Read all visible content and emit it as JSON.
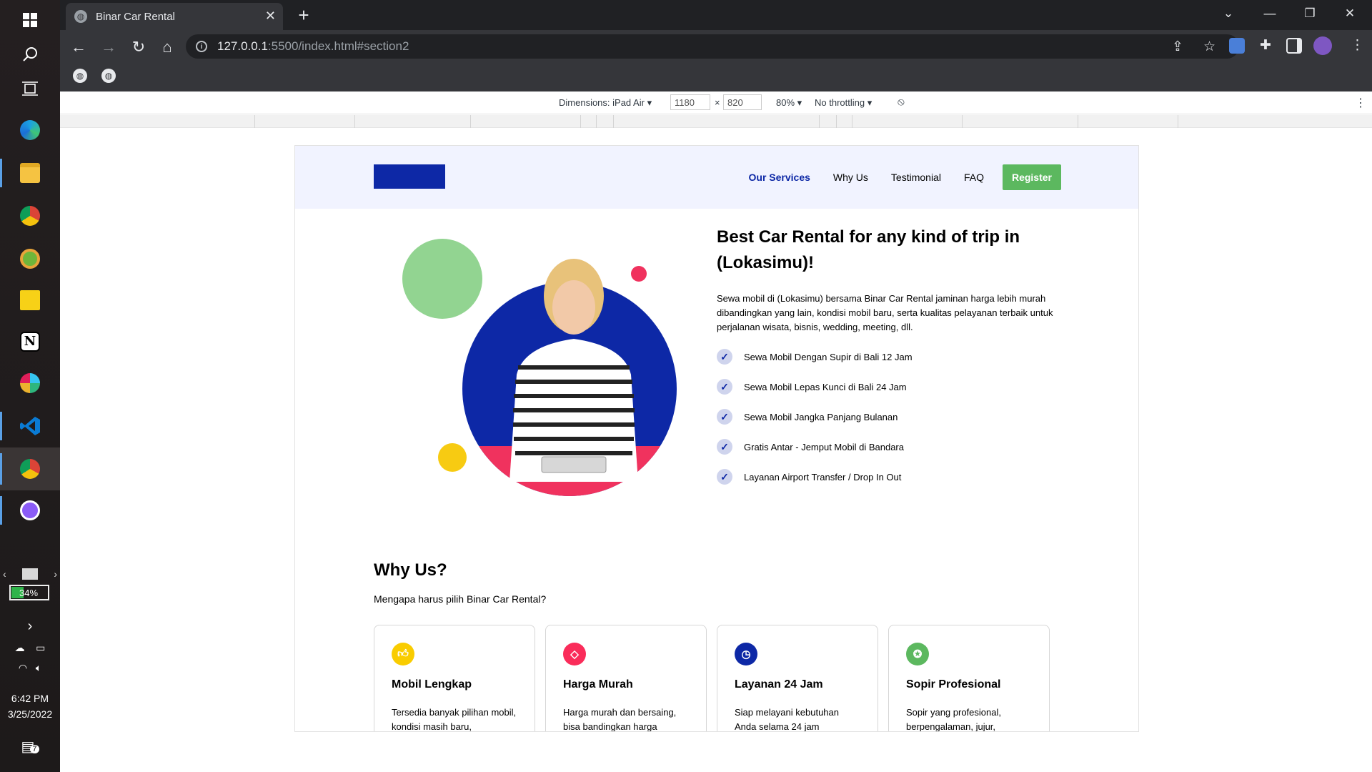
{
  "taskbar": {
    "apps": [
      {
        "icon": "windows-start-icon",
        "color": "#ffffff"
      },
      {
        "icon": "search-icon",
        "color": "#ffffff"
      },
      {
        "icon": "task-view-icon",
        "color": "#ffffff"
      },
      {
        "icon": "edge-icon",
        "color": "#1ba1e2"
      },
      {
        "icon": "file-explorer-icon",
        "color": "#f5c342"
      },
      {
        "icon": "chrome-icon",
        "color": "#db4437"
      },
      {
        "icon": "chameleon-app-icon",
        "color": "#e8a43a"
      },
      {
        "icon": "sticky-notes-icon",
        "color": "#f7d117"
      },
      {
        "icon": "notion-icon",
        "color": "#ffffff"
      },
      {
        "icon": "slack-icon",
        "color": "#e01e5a"
      },
      {
        "icon": "vscode-icon",
        "color": "#0a7bd4"
      },
      {
        "icon": "chrome-active-icon",
        "color": "#db4437"
      },
      {
        "icon": "github-desktop-icon",
        "color": "#8b5cf6"
      }
    ],
    "battery": "34%",
    "time": "6:42 PM",
    "date": "3/25/2022",
    "notification_count": "7"
  },
  "browser": {
    "tab_title": "Binar Car Rental",
    "url_host": "127.0.0.1",
    "url_path": ":5500/index.html#section2"
  },
  "devtools": {
    "dimensions_label": "Dimensions: iPad Air",
    "width": "1180",
    "height": "820",
    "times": "×",
    "zoom": "80%",
    "throttling": "No throttling"
  },
  "site": {
    "nav": {
      "items": [
        "Our Services",
        "Why Us",
        "Testimonial",
        "FAQ"
      ],
      "register": "Register"
    },
    "hero": {
      "title": "Best Car Rental for any kind of trip in (Lokasimu)!",
      "description": "Sewa mobil di (Lokasimu) bersama Binar Car Rental jaminan harga lebih murah dibandingkan yang lain, kondisi mobil baru, serta kualitas pelayanan terbaik untuk perjalanan wisata, bisnis, wedding, meeting, dll.",
      "features": [
        "Sewa Mobil Dengan Supir di Bali 12 Jam",
        "Sewa Mobil Lepas Kunci di Bali 24 Jam",
        "Sewa Mobil Jangka Panjang Bulanan",
        "Gratis Antar - Jemput Mobil di Bandara",
        "Layanan Airport Transfer / Drop In Out"
      ]
    },
    "why": {
      "title": "Why Us?",
      "subtitle": "Mengapa harus pilih Binar Car Rental?",
      "cards": [
        {
          "title": "Mobil Lengkap",
          "text": "Tersedia banyak pilihan mobil, kondisi masih baru,",
          "icon": "thumbs-up-icon",
          "color": "#f9cc00"
        },
        {
          "title": "Harga Murah",
          "text": "Harga murah dan bersaing, bisa bandingkan harga",
          "icon": "price-tag-icon",
          "color": "#fa2c5a"
        },
        {
          "title": "Layanan 24 Jam",
          "text": "Siap melayani kebutuhan Anda selama 24 jam",
          "icon": "clock-icon",
          "color": "#0d28a6"
        },
        {
          "title": "Sopir Profesional",
          "text": "Sopir yang profesional, berpengalaman, jujur,",
          "icon": "award-icon",
          "color": "#5cb85f"
        }
      ]
    }
  },
  "colors": {
    "brand_blue": "#0d28a6",
    "brand_green": "#5cb85f",
    "header_bg": "#f1f3ff"
  }
}
